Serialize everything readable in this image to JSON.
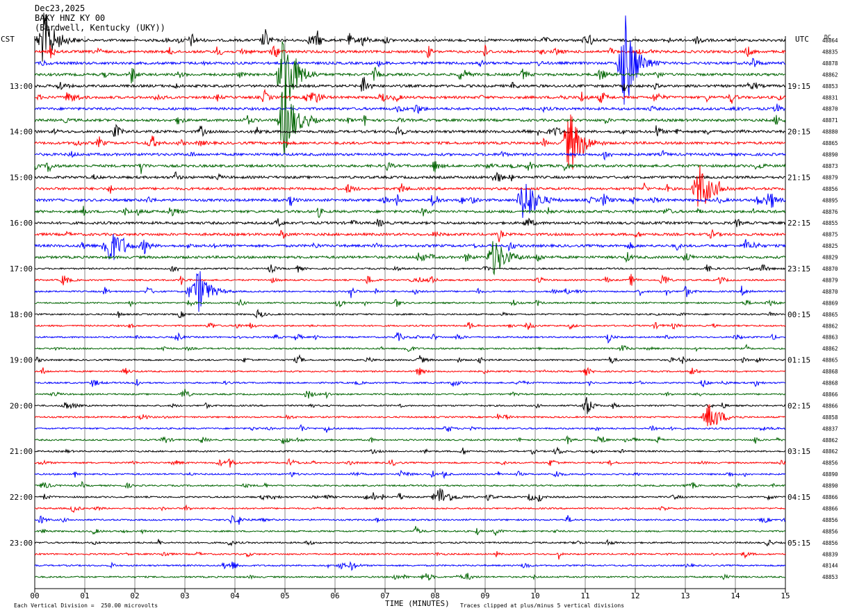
{
  "header": {
    "date": "Dec23,2025",
    "station": "BAKY HNZ KY 00",
    "location": "(Bardwell, Kentucky (UKY))"
  },
  "left_tz": "CST",
  "right_tz": "UTC",
  "dc_label": "DC",
  "footer": {
    "left": "Each Vertical Division =  250.00 microvolts",
    "xlabel": "TIME (MINUTES)",
    "right": "Traces clipped at plus/minus 5 vertical divisions"
  },
  "colors": {
    "trace_cycle": [
      "#000000",
      "#ff0000",
      "#0000ff",
      "#006400"
    ],
    "grid": "#000000",
    "background": "#ffffff"
  },
  "chart_data": {
    "type": "line",
    "title": "BAKY HNZ KY 00",
    "xlabel": "TIME (MINUTES)",
    "xlim": [
      0,
      15
    ],
    "x_ticks": [
      "00",
      "01",
      "02",
      "03",
      "04",
      "05",
      "06",
      "07",
      "08",
      "09",
      "10",
      "11",
      "12",
      "13",
      "14",
      "15"
    ],
    "left_hour_labels": [
      "13:00",
      "14:00",
      "15:00",
      "16:00",
      "17:00",
      "18:00",
      "19:00",
      "20:00",
      "21:00",
      "22:00",
      "23:00"
    ],
    "right_hour_labels": [
      "19:15",
      "20:15",
      "21:15",
      "22:15",
      "23:15",
      "00:15",
      "01:15",
      "02:15",
      "03:15",
      "04:15",
      "05:15"
    ],
    "trace_count": 48,
    "dc_offsets": [
      "48864",
      "48835",
      "48878",
      "48862",
      "48853",
      "48831",
      "48870",
      "48871",
      "48880",
      "48865",
      "48890",
      "48873",
      "48879",
      "48856",
      "48895",
      "48876",
      "48855",
      "48875",
      "48825",
      "48829",
      "48870",
      "48879",
      "48870",
      "48869",
      "48865",
      "48862",
      "48863",
      "48862",
      "48865",
      "48868",
      "48868",
      "48866",
      "48866",
      "48858",
      "48837",
      "48862",
      "48862",
      "48856",
      "48890",
      "48890",
      "48866",
      "48866",
      "48856",
      "48856",
      "48856",
      "48839",
      "48144",
      "48853"
    ],
    "notable_events": [
      {
        "trace": 0,
        "minute": 0.2,
        "amplitude_div": 3
      },
      {
        "trace": 2,
        "minute": 11.8,
        "amplitude_div": 5
      },
      {
        "trace": 3,
        "minute": 5.0,
        "amplitude_div": 5
      },
      {
        "trace": 7,
        "minute": 5.0,
        "amplitude_div": 4
      },
      {
        "trace": 9,
        "minute": 10.7,
        "amplitude_div": 3
      },
      {
        "trace": 13,
        "minute": 13.3,
        "amplitude_div": 2.5
      },
      {
        "trace": 14,
        "minute": 9.8,
        "amplitude_div": 2.5
      },
      {
        "trace": 18,
        "minute": 1.5,
        "amplitude_div": 2
      },
      {
        "trace": 19,
        "minute": 9.2,
        "amplitude_div": 2
      },
      {
        "trace": 22,
        "minute": 3.3,
        "amplitude_div": 2
      },
      {
        "trace": 33,
        "minute": 13.5,
        "amplitude_div": 1.5
      },
      {
        "trace": 40,
        "minute": 8.1,
        "amplitude_div": 1
      }
    ]
  }
}
